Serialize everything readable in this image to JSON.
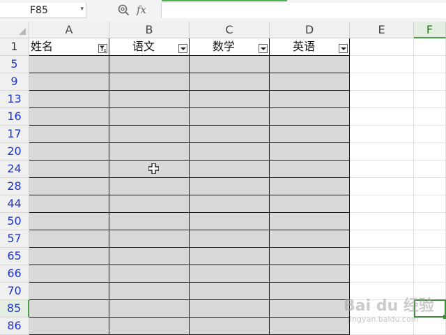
{
  "formula_bar": {
    "name_box": "F85",
    "fx_label": "fx",
    "formula_value": ""
  },
  "columns": [
    "A",
    "B",
    "C",
    "D",
    "E",
    "F"
  ],
  "header_row": {
    "row_number": "1",
    "cells": [
      "姓名",
      "语文",
      "数学",
      "英语"
    ]
  },
  "rows": [
    "5",
    "9",
    "13",
    "16",
    "17",
    "20",
    "24",
    "28",
    "44",
    "50",
    "57",
    "65",
    "66",
    "70",
    "85",
    "86"
  ],
  "selected_cell": "F85",
  "icons": {
    "name_box_dropdown": "chevron-down-icon",
    "zoom": "zoom-icon",
    "filter_active": "filter-active-icon",
    "filter_dropdown": "filter-dropdown-icon",
    "cursor": "crosshair-cursor-icon",
    "select_all": "select-all-icon"
  },
  "colors": {
    "selection_green": "#3f8c3b",
    "row_number_blue": "#1f35c8",
    "filled_cell_gray": "#d9d9d9"
  },
  "watermark": {
    "main": "Bai du 经验",
    "sub": "jingyan.baidu.com"
  }
}
